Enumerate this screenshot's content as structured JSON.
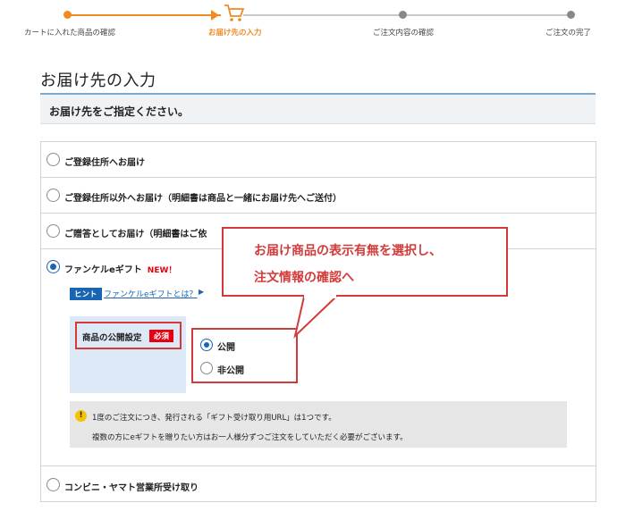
{
  "progress": {
    "steps": [
      "カートに入れた商品の確認",
      "お届け先の入力",
      "ご注文内容の確認",
      "ご注文の完了"
    ],
    "active_step": "お届け先の入力",
    "accent_color": "#f08a24",
    "inactive_color": "#c8c8c8",
    "active_icon": "cart-icon"
  },
  "page": {
    "title": "お届け先の入力",
    "subtitle": "お届け先をご指定ください。"
  },
  "options": [
    {
      "label": "ご登録住所へお届け",
      "selected": false
    },
    {
      "label": "ご登録住所以外へお届け（明細書は商品と一緒にお届け先へご送付）",
      "selected": false
    },
    {
      "label": "ご贈答としてお届け（明細書はご依",
      "selected": false
    },
    {
      "label": "ファンケルeギフト",
      "badge": "NEW！",
      "selected": true
    },
    {
      "label": "コンビニ・ヤマト営業所受け取り",
      "selected": false
    }
  ],
  "egift": {
    "hint_tag": "ヒント",
    "hint_link": "ファンケルeギフトとは？",
    "setting_label": "商品の公開設定",
    "required_badge": "必須",
    "choices": [
      {
        "label": "公開",
        "selected": true
      },
      {
        "label": "非公開",
        "selected": false
      }
    ],
    "notice_line1": "1度のご注文につき、発行される「ギフト受け取り用URL」は1つです。",
    "notice_line2": "複数の方にeギフトを贈りたい方はお一人様分ずつご注文をしていただく必要がございます。"
  },
  "callout": {
    "line1": "お届け商品の表示有無を選択し、",
    "line2": "注文情報の確認へ",
    "color": "#d33a3a"
  },
  "colors": {
    "brand_blue": "#1a64b4",
    "required_red": "#e60012",
    "panel_blue": "#dde9f7"
  }
}
